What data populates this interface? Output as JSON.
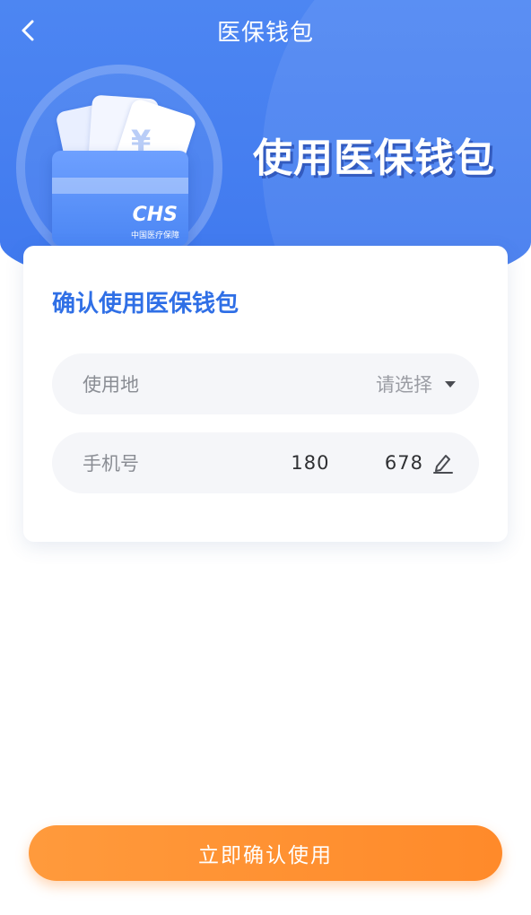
{
  "header": {
    "title": "医保钱包"
  },
  "hero": {
    "title": "使用医保钱包",
    "logo_text": "CHS",
    "logo_subtext": "中国医疗保障",
    "yen_symbol": "¥"
  },
  "panel": {
    "title": "确认使用医保钱包",
    "fields": [
      {
        "label": "使用地",
        "value": "请选择"
      },
      {
        "label": "手机号",
        "value": "180        678"
      }
    ]
  },
  "footer": {
    "confirm_label": "立即确认使用"
  },
  "colors": {
    "primary_blue": "#4d86f2",
    "accent_orange": "#ff8a2a",
    "title_blue": "#2f6fe6"
  }
}
